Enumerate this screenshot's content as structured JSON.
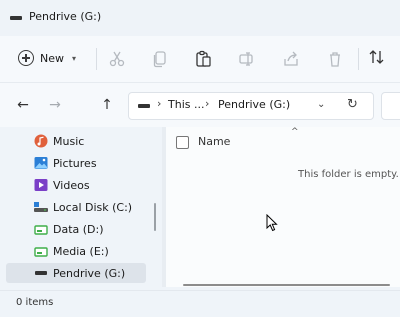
{
  "window": {
    "title": "Pendrive (G:)"
  },
  "toolbar": {
    "new_label": "New",
    "icons": [
      "cut-icon",
      "copy-icon",
      "paste-icon",
      "rename-icon",
      "share-icon",
      "delete-icon",
      "sort-icon"
    ]
  },
  "navigation": {
    "back": "←",
    "forward": "→",
    "up": "↑",
    "address": {
      "crumbs": [
        "This ...",
        "Pendrive (G:)"
      ],
      "separator": "›",
      "dropdown": "⌄",
      "refresh": "↻"
    }
  },
  "sidebar": {
    "items": [
      {
        "label": "Music",
        "icon": "music-icon",
        "color": "#e0603c"
      },
      {
        "label": "Pictures",
        "icon": "pictures-icon",
        "color": "#2b7fd6"
      },
      {
        "label": "Videos",
        "icon": "videos-icon",
        "color": "#7a3fc7"
      },
      {
        "label": "Local Disk (C:)",
        "icon": "local-disk-icon",
        "color": "#555555"
      },
      {
        "label": "Data (D:)",
        "icon": "drive-icon",
        "color": "#3fae49"
      },
      {
        "label": "Media (E:)",
        "icon": "drive-icon",
        "color": "#3fae49"
      },
      {
        "label": "Pendrive (G:)",
        "icon": "usb-drive-icon",
        "color": "#333333",
        "selected": true
      }
    ]
  },
  "content": {
    "column_header": "Name",
    "sort_indicator": "^",
    "empty_message": "This folder is empty."
  },
  "status": {
    "item_count": "0 items"
  }
}
